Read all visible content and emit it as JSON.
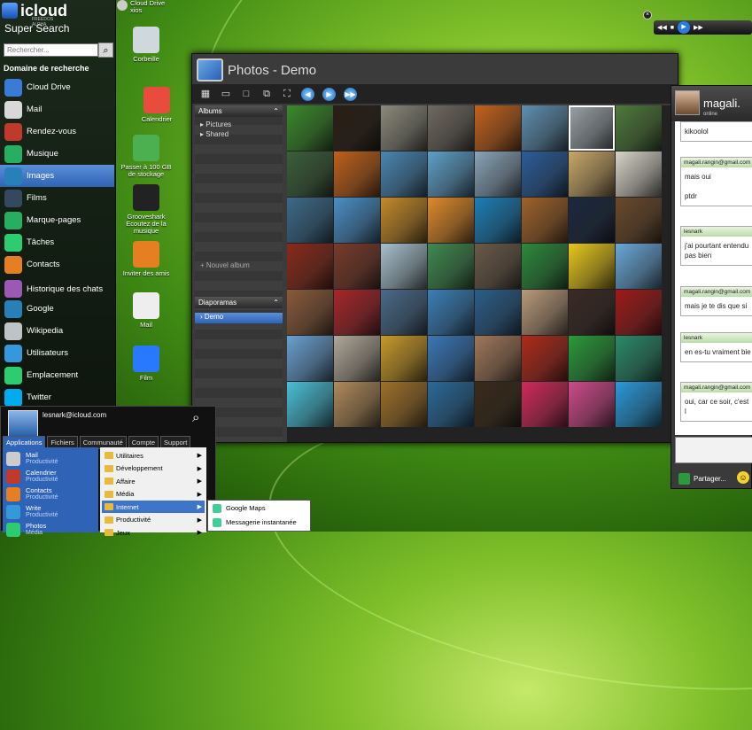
{
  "left_panel": {
    "logo": "icloud",
    "logo_sub": "FREEDOS ALPHA",
    "title": "Super Search",
    "search_placeholder": "Rechercher...",
    "domain_label": "Domaine de recherche",
    "items": [
      {
        "label": "Cloud Drive",
        "icon": "cloud-drive-icon",
        "color": "#3a7bd5"
      },
      {
        "label": "Mail",
        "icon": "mail-icon",
        "color": "#d8d8d8"
      },
      {
        "label": "Rendez-vous",
        "icon": "calendar-icon",
        "color": "#c0392b"
      },
      {
        "label": "Musique",
        "icon": "music-icon",
        "color": "#27ae60"
      },
      {
        "label": "Images",
        "icon": "images-icon",
        "color": "#2980b9",
        "selected": true
      },
      {
        "label": "Films",
        "icon": "film-icon",
        "color": "#34495e"
      },
      {
        "label": "Marque-pages",
        "icon": "bookmark-icon",
        "color": "#27ae60"
      },
      {
        "label": "Tâches",
        "icon": "tasks-icon",
        "color": "#2ecc71"
      },
      {
        "label": "Contacts",
        "icon": "contacts-icon",
        "color": "#e67e22"
      },
      {
        "label": "Historique des chats",
        "icon": "chat-history-icon",
        "color": "#9b59b6"
      },
      {
        "label": "Google",
        "icon": "google-icon",
        "color": "#2980b9"
      },
      {
        "label": "Wikipedia",
        "icon": "wikipedia-icon",
        "color": "#bdc3c7"
      },
      {
        "label": "Utilisateurs",
        "icon": "users-icon",
        "color": "#3498db"
      },
      {
        "label": "Emplacement",
        "icon": "location-icon",
        "color": "#2ecc71"
      },
      {
        "label": "Twitter",
        "icon": "twitter-icon",
        "color": "#00aced"
      }
    ]
  },
  "desktop": {
    "icons": [
      {
        "label": "Cloud Drive\nxios",
        "icon": "cloud-drive-icon"
      },
      {
        "label": "Corbeille",
        "icon": "trash-icon"
      },
      {
        "label": "Calendrier",
        "icon": "calendar-icon"
      },
      {
        "label": "Passer à 100 GB de stockage",
        "icon": "storage-upgrade-icon"
      },
      {
        "label": "Grooveshark Ecoutez de la musique",
        "icon": "grooveshark-icon"
      },
      {
        "label": "Inviter des amis",
        "icon": "invite-friends-icon"
      },
      {
        "label": "Mail",
        "icon": "mail-icon"
      },
      {
        "label": "Film",
        "icon": "film-icon"
      }
    ]
  },
  "photos": {
    "title": "Photos - Demo",
    "albums_header": "Albums",
    "albums": [
      "Pictures",
      "Shared"
    ],
    "new_album": "+ Nouvel album",
    "slideshows_header": "Diaporamas",
    "slideshows": [
      "Demo"
    ],
    "thumbs": [
      "#3a8a2a",
      "#2a1e14",
      "#8c8a7a",
      "#6f6a60",
      "#c4621c",
      "#5f8fb0",
      "#9aa3a8",
      "#4e7a3a",
      "#3b5f3a",
      "#c0601a",
      "#4a86b2",
      "#5fa0c8",
      "#8aa4b8",
      "#2b5d9a",
      "#c9a86a",
      "#d8d4c8",
      "#3c6a8a",
      "#4a8fc7",
      "#c48a2a",
      "#e08a2a",
      "#1c7fb8",
      "#a0622a",
      "#1a2840",
      "#6a4a2a",
      "#8a2a1a",
      "#7a3a2a",
      "#a8c0cc",
      "#3f8a4f",
      "#6a5a48",
      "#2c8a3a",
      "#e8c81a",
      "#6aa8d8",
      "#8a5a3a",
      "#a8262a",
      "#4a6a8a",
      "#3b7fb8",
      "#2b5e8a",
      "#b89a7a",
      "#3a2a24",
      "#a01a1a",
      "#6aa0d0",
      "#b0a898",
      "#c89a2a",
      "#3a78b8",
      "#a0785a",
      "#b02a1a",
      "#2a9a3a",
      "#2a8a6a",
      "#4ac0d8",
      "#b08a5a",
      "#a0702a",
      "#2a6a9a",
      "#3a2a1a",
      "#d02a5a",
      "#d04a8a",
      "#2a9adb"
    ]
  },
  "chat": {
    "user": "magali.",
    "status": "online",
    "header_hint": "Photo de profil",
    "messages": [
      {
        "who": "",
        "text": "kikoolol"
      },
      {
        "who": "magali.rangin@gmail.com",
        "text": "mais oui\n\nptdr"
      },
      {
        "who": "lesnark",
        "text": "j'ai pourtant entendu pas bien"
      },
      {
        "who": "magali.rangin@gmail.com",
        "text": "mais je te dis que si"
      },
      {
        "who": "lesnark",
        "text": "en es-tu vraiment bie"
      },
      {
        "who": "magali.rangin@gmail.com",
        "text": "oui, car ce soir, c'est l"
      }
    ],
    "share": "Partager..."
  },
  "media": {
    "controls": [
      "◀◀",
      "■",
      "▶",
      "▶▶"
    ]
  },
  "start_menu": {
    "user": "lesnark@icloud.com",
    "tabs": [
      "Applications",
      "Fichiers",
      "Communauté",
      "Compte",
      "Support"
    ],
    "apps": [
      {
        "name": "Mail",
        "cat": "Productivité",
        "color": "#ccc"
      },
      {
        "name": "Calendrier",
        "cat": "Productivité",
        "color": "#c0392b"
      },
      {
        "name": "Contacts",
        "cat": "Productivité",
        "color": "#e67e22"
      },
      {
        "name": "Write",
        "cat": "Productivité",
        "color": "#3498db"
      },
      {
        "name": "Photos",
        "cat": "Média",
        "color": "#2ecc71"
      }
    ],
    "categories": [
      "Utilitaires",
      "Développement",
      "Affaire",
      "Média",
      "Internet",
      "Productivité",
      "Jeux"
    ],
    "sub": [
      "Google Maps",
      "Messagerie instantanée"
    ]
  }
}
